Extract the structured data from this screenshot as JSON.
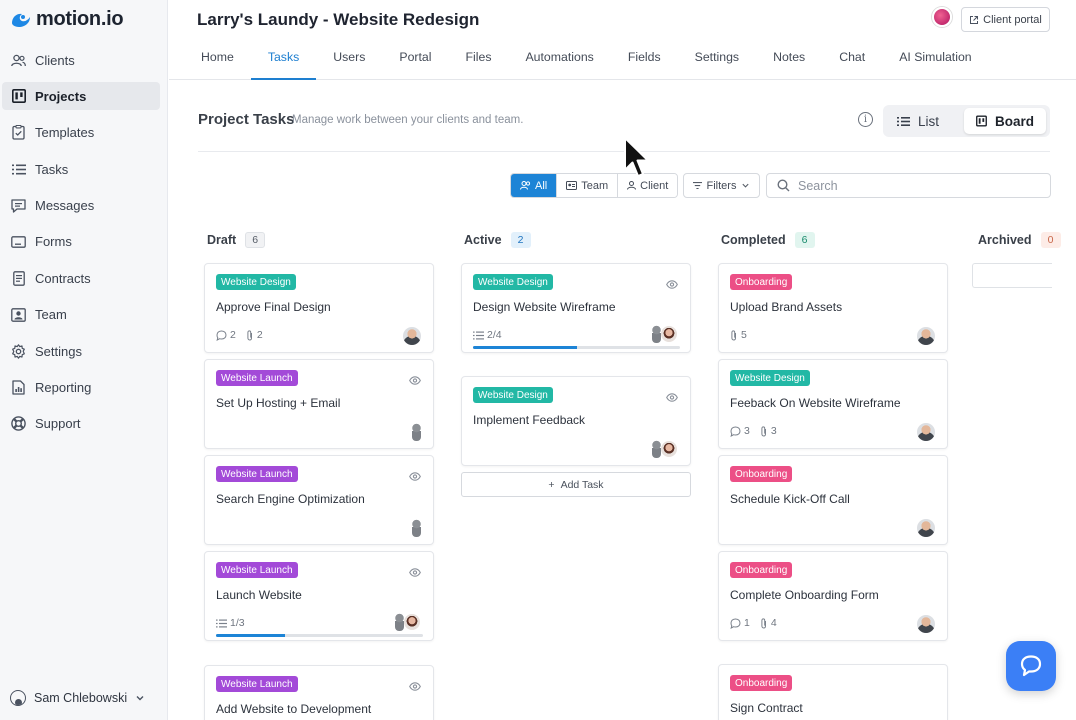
{
  "app": {
    "logo_text": "motion.io",
    "logo_dot": ""
  },
  "sidebar": {
    "items": [
      {
        "label": "Clients",
        "icon": "users-icon"
      },
      {
        "label": "Projects",
        "icon": "projects-icon",
        "active": true
      },
      {
        "label": "Templates",
        "icon": "template-icon"
      },
      {
        "label": "Tasks",
        "icon": "list-icon"
      },
      {
        "label": "Messages",
        "icon": "message-icon"
      },
      {
        "label": "Forms",
        "icon": "form-icon"
      },
      {
        "label": "Contracts",
        "icon": "contract-icon"
      },
      {
        "label": "Team",
        "icon": "team-icon"
      },
      {
        "label": "Settings",
        "icon": "gear-icon"
      },
      {
        "label": "Reporting",
        "icon": "reporting-icon"
      },
      {
        "label": "Support",
        "icon": "support-icon"
      }
    ],
    "user_name": "Sam Chlebowski"
  },
  "header": {
    "project_title": "Larry's Laundy - Website Redesign",
    "client_portal_label": "Client portal",
    "tabs": [
      "Home",
      "Tasks",
      "Users",
      "Portal",
      "Files",
      "Automations",
      "Fields",
      "Settings",
      "Notes",
      "Chat",
      "AI Simulation"
    ],
    "active_tab": "Tasks"
  },
  "project_tasks": {
    "title": "Project Tasks",
    "subtitle": "Manage work between your clients and team.",
    "view_list_label": "List",
    "view_board_label": "Board",
    "active_view": "Board"
  },
  "filters": {
    "segments": [
      "All",
      "Team",
      "Client"
    ],
    "active_segment": "All",
    "filters_label": "Filters",
    "search_placeholder": "Search",
    "search_value": ""
  },
  "columns": [
    {
      "name": "Draft",
      "count": "6",
      "count_style": "gray",
      "cards": [
        {
          "tag": "Website Design",
          "tag_style": "design",
          "title": "Approve Final Design",
          "comments": "2",
          "attachments": "2",
          "eye": false,
          "avatars": [
            "man"
          ]
        },
        {
          "tag": "Website Launch",
          "tag_style": "launch",
          "title": "Set Up Hosting + Email",
          "eye": true,
          "avatars": [
            "mini"
          ]
        },
        {
          "tag": "Website Launch",
          "tag_style": "launch",
          "title": "Search Engine Optimization",
          "eye": true,
          "avatars": [
            "mini"
          ]
        },
        {
          "tag": "Website Launch",
          "tag_style": "launch",
          "title": "Launch Website",
          "eye": true,
          "checklist": "1/3",
          "progress": 0.333,
          "avatars": [
            "mini",
            "woman"
          ]
        },
        {
          "tag": "Website Launch",
          "tag_style": "launch",
          "title": "Add Website to Development",
          "eye": true,
          "avatars": []
        }
      ]
    },
    {
      "name": "Active",
      "count": "2",
      "count_style": "blue",
      "cards": [
        {
          "tag": "Website Design",
          "tag_style": "design",
          "title": "Design Website Wireframe",
          "eye": true,
          "checklist": "2/4",
          "progress": 0.5,
          "avatars": [
            "mini",
            "woman"
          ]
        },
        {
          "tag": "Website Design",
          "tag_style": "design",
          "title": "Implement Feedback",
          "eye": true,
          "avatars": [
            "mini",
            "woman"
          ]
        }
      ],
      "add_task_label": "Add Task"
    },
    {
      "name": "Completed",
      "count": "6",
      "count_style": "green",
      "cards": [
        {
          "tag": "Onboarding",
          "tag_style": "onboarding",
          "title": "Upload Brand Assets",
          "attachments": "5",
          "eye": false,
          "avatars": [
            "man"
          ]
        },
        {
          "tag": "Website Design",
          "tag_style": "design",
          "title": "Feeback On Website Wireframe",
          "comments": "3",
          "attachments": "3",
          "eye": false,
          "avatars": [
            "man"
          ]
        },
        {
          "tag": "Onboarding",
          "tag_style": "onboarding",
          "title": "Schedule Kick-Off Call",
          "eye": false,
          "avatars": [
            "man"
          ]
        },
        {
          "tag": "Onboarding",
          "tag_style": "onboarding",
          "title": "Complete Onboarding Form",
          "comments": "1",
          "attachments": "4",
          "eye": false,
          "avatars": [
            "man"
          ]
        },
        {
          "tag": "Onboarding",
          "tag_style": "onboarding",
          "title": "Sign Contract",
          "eye": false,
          "avatars": [
            "man"
          ]
        }
      ]
    },
    {
      "name": "Archived",
      "count": "0",
      "count_style": "peach",
      "cards": []
    }
  ],
  "colors": {
    "accent": "#1d84d6",
    "design_tag": "#22b8a5",
    "launch_tag": "#a34ad8",
    "onboarding_tag": "#ec4f86",
    "chat_bubble": "#3b7ff6"
  }
}
